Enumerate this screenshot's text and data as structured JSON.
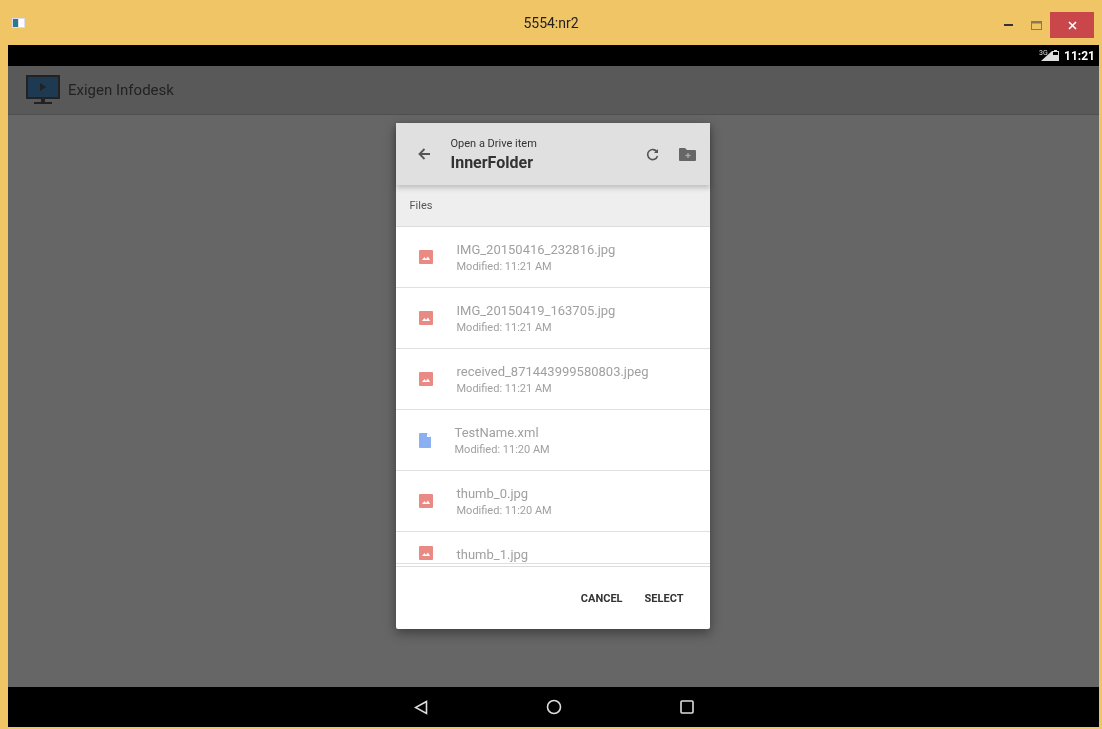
{
  "window": {
    "title": "5554:nr2"
  },
  "status_bar": {
    "time": "11:21",
    "network": "3G"
  },
  "app_bar": {
    "title": "Exigen Infodesk"
  },
  "dialog": {
    "subtitle": "Open a Drive item",
    "title": "InnerFolder",
    "section": "Files",
    "files": [
      {
        "kind": "image",
        "name": "IMG_20150416_232816.jpg",
        "modified": "Modified: 11:21 AM"
      },
      {
        "kind": "image",
        "name": "IMG_20150419_163705.jpg",
        "modified": "Modified: 11:21 AM"
      },
      {
        "kind": "image",
        "name": "received_871443999580803.jpeg",
        "modified": "Modified: 11:21 AM"
      },
      {
        "kind": "document",
        "name": "TestName.xml",
        "modified": "Modified: 11:20 AM"
      },
      {
        "kind": "image",
        "name": "thumb_0.jpg",
        "modified": "Modified: 11:20 AM"
      },
      {
        "kind": "image",
        "name": "thumb_1.jpg"
      }
    ],
    "buttons": [
      "CANCEL",
      "SELECT"
    ]
  }
}
